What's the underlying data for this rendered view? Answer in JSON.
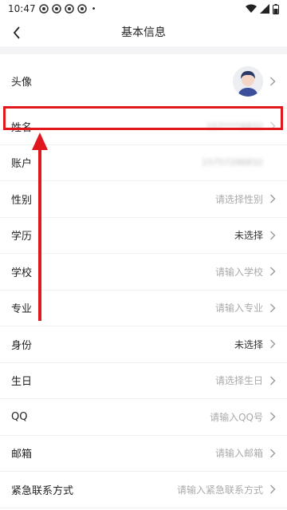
{
  "status_bar": {
    "time": "10:47",
    "dot": "•"
  },
  "nav": {
    "title": "基本信息"
  },
  "rows": [
    {
      "label": "头像",
      "kind": "avatar"
    },
    {
      "label": "姓名",
      "value": "157****6832",
      "kind": "blur"
    },
    {
      "label": "账户",
      "value": "15757286832",
      "kind": "blur"
    },
    {
      "label": "性别",
      "value": "请选择性别",
      "kind": "placeholder"
    },
    {
      "label": "学历",
      "value": "未选择",
      "kind": "value"
    },
    {
      "label": "学校",
      "value": "请输入学校",
      "kind": "placeholder"
    },
    {
      "label": "专业",
      "value": "请输入专业",
      "kind": "placeholder"
    },
    {
      "label": "身份",
      "value": "未选择",
      "kind": "value"
    },
    {
      "label": "生日",
      "value": "请选择生日",
      "kind": "placeholder"
    },
    {
      "label": "QQ",
      "value": "请输入QQ号",
      "kind": "placeholder"
    },
    {
      "label": "邮箱",
      "value": "请输入邮箱",
      "kind": "placeholder"
    },
    {
      "label": "紧急联系方式",
      "value": "请输入紧急联系方式",
      "kind": "placeholder"
    }
  ],
  "colors": {
    "annotation_red": "#e0171c",
    "placeholder": "#aaaaaa"
  }
}
